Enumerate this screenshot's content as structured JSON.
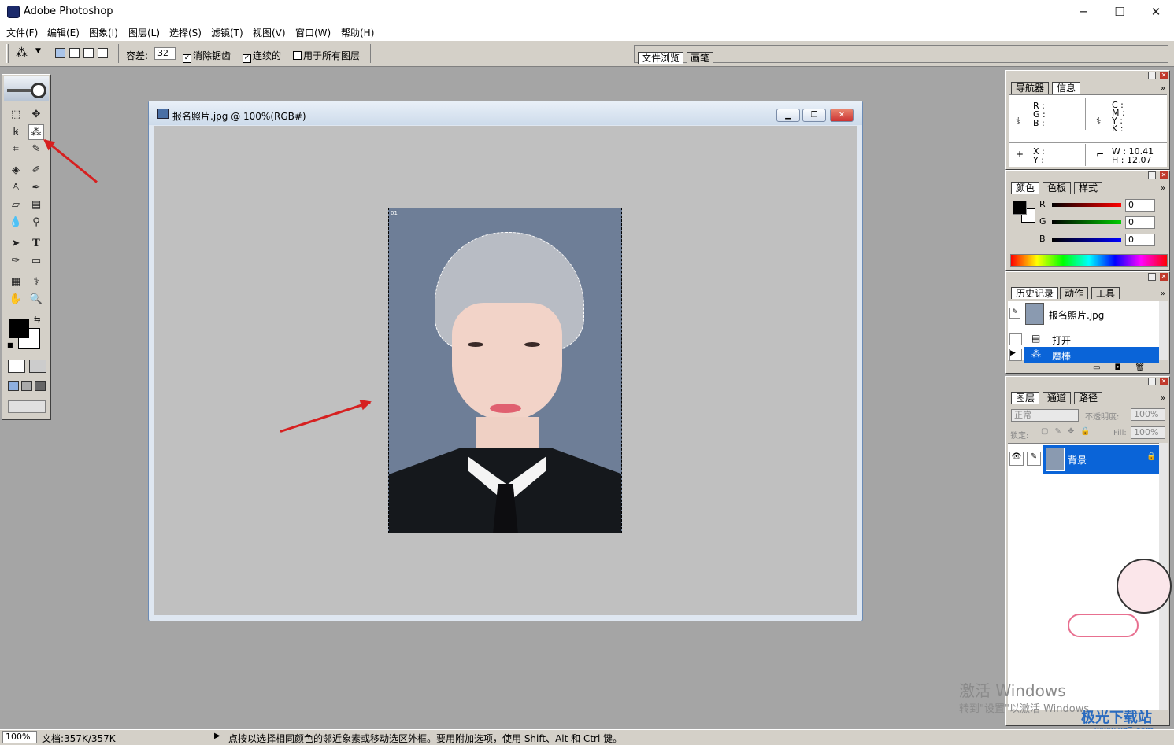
{
  "app": {
    "title": "Adobe Photoshop",
    "icon": "photoshop-icon"
  },
  "window_controls": {
    "minimize": "─",
    "maximize": "☐",
    "close": "✕"
  },
  "menus": [
    "文件(F)",
    "编辑(E)",
    "图象(I)",
    "图层(L)",
    "选择(S)",
    "滤镜(T)",
    "视图(V)",
    "窗口(W)",
    "帮助(H)"
  ],
  "options": {
    "tolerance_label": "容差:",
    "tolerance_value": "32",
    "anti_alias": {
      "label": "消除锯齿",
      "checked": true
    },
    "contiguous": {
      "label": "连续的",
      "checked": true
    },
    "all_layers": {
      "label": "用于所有图层",
      "checked": false
    }
  },
  "palette_well": {
    "tabs": [
      "文件浏览",
      "画笔"
    ]
  },
  "document": {
    "title": "报名照片.jpg @ 100%(RGB#)",
    "buttons": {
      "minimize": "▁",
      "restore": "❐",
      "close": "✕"
    }
  },
  "navigator_panel": {
    "tabs": [
      "导航器",
      "信息"
    ],
    "rgb_labels": [
      "R :",
      "G :",
      "B :"
    ],
    "cmyk_labels": [
      "C :",
      "M :",
      "Y :",
      "K :"
    ],
    "xy_labels": [
      "X :",
      "Y :"
    ],
    "w_label": "W :",
    "w_value": "10.41",
    "h_label": "H :",
    "h_value": "12.07"
  },
  "color_panel": {
    "tabs": [
      "颜色",
      "色板",
      "样式"
    ],
    "channels": [
      {
        "label": "R",
        "value": "0",
        "color": "#d00000"
      },
      {
        "label": "G",
        "value": "0",
        "color": "#00a000"
      },
      {
        "label": "B",
        "value": "0",
        "color": "#0000d0"
      }
    ]
  },
  "history_panel": {
    "tabs": [
      "历史记录",
      "动作",
      "工具"
    ],
    "snapshot": "报名照片.jpg",
    "steps": [
      {
        "label": "打开",
        "selected": false
      },
      {
        "label": "魔棒",
        "selected": true
      }
    ]
  },
  "layers_panel": {
    "tabs": [
      "图层",
      "通道",
      "路径"
    ],
    "blend_mode": "正常",
    "opacity_label": "不透明度:",
    "opacity_value": "100%",
    "lock_label": "锁定:",
    "fill_label": "Fill:",
    "fill_value": "100%",
    "layers": [
      {
        "name": "背景",
        "selected": true,
        "locked": true
      }
    ]
  },
  "status": {
    "zoom": "100%",
    "doc_size": "文档:357K/357K",
    "hint": "点按以选择相同颜色的邻近象素或移动选区外框。要用附加选项，使用 Shift、Alt 和 Ctrl 键。"
  },
  "watermarks": {
    "windows_line1": "激活 Windows",
    "windows_line2": "转到\"设置\"以激活 Windows。",
    "site_name": "极光下载站",
    "site_url": "www.xz7.com"
  },
  "colors": {
    "selection_blue": "#0a64d8",
    "arrow_red": "#d62020",
    "photo_bg": "#6e7e97"
  }
}
